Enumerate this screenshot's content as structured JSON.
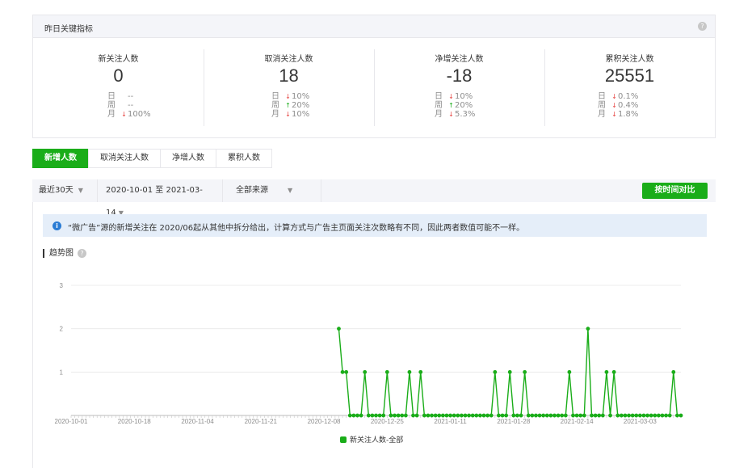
{
  "kpi": {
    "title": "昨日关键指标",
    "help": "?",
    "items": [
      {
        "label": "新关注人数",
        "value": "0",
        "rows": [
          {
            "k": "日",
            "arrow": "",
            "dir": "",
            "v": "--"
          },
          {
            "k": "周",
            "arrow": "",
            "dir": "",
            "v": "--"
          },
          {
            "k": "月",
            "arrow": "↓",
            "dir": "down",
            "v": "100%"
          }
        ]
      },
      {
        "label": "取消关注人数",
        "value": "18",
        "rows": [
          {
            "k": "日",
            "arrow": "↓",
            "dir": "down",
            "v": "10%"
          },
          {
            "k": "周",
            "arrow": "↑",
            "dir": "up",
            "v": "20%"
          },
          {
            "k": "月",
            "arrow": "↓",
            "dir": "down",
            "v": "10%"
          }
        ]
      },
      {
        "label": "净增关注人数",
        "value": "-18",
        "rows": [
          {
            "k": "日",
            "arrow": "↓",
            "dir": "down",
            "v": "10%"
          },
          {
            "k": "周",
            "arrow": "↑",
            "dir": "up",
            "v": "20%"
          },
          {
            "k": "月",
            "arrow": "↓",
            "dir": "down",
            "v": "5.3%"
          }
        ]
      },
      {
        "label": "累积关注人数",
        "value": "25551",
        "rows": [
          {
            "k": "日",
            "arrow": "↓",
            "dir": "down",
            "v": "0.1%"
          },
          {
            "k": "周",
            "arrow": "↓",
            "dir": "down",
            "v": "0.4%"
          },
          {
            "k": "月",
            "arrow": "↓",
            "dir": "down",
            "v": "1.8%"
          }
        ]
      }
    ]
  },
  "tabs": [
    {
      "label": "新增人数",
      "active": true
    },
    {
      "label": "取消关注人数",
      "active": false
    },
    {
      "label": "净增人数",
      "active": false
    },
    {
      "label": "累积人数",
      "active": false
    }
  ],
  "filters": {
    "period": "最近30天",
    "date_range": "2020-10-01 至 2021-03-14",
    "source": "全部来源",
    "caret": "▼",
    "compare_label": "按时间对比"
  },
  "notice": {
    "icon": "i",
    "text": "“微广告”源的新增关注在 2020/06起从其他中拆分给出，计算方式与广告主页面关注次数略有不同，因此两者数值可能不一样。"
  },
  "trend": {
    "title": "趋势图",
    "help": "?"
  },
  "colors": {
    "accent": "#1aad19",
    "down": "#e64340",
    "up": "#1aad19"
  },
  "chart_data": {
    "type": "line",
    "x_start": "2020-10-01",
    "x_end": "2021-03-14",
    "x_ticks": [
      "2020-10-01",
      "2020-10-18",
      "2020-11-04",
      "2020-11-21",
      "2020-12-08",
      "2020-12-25",
      "2021-01-11",
      "2021-01-28",
      "2021-02-14",
      "2021-03-03"
    ],
    "y_ticks": [
      1,
      2,
      3
    ],
    "ylim": [
      0,
      3
    ],
    "series": [
      {
        "name": "新关注人数-全部",
        "points": [
          [
            "2020-12-12",
            2
          ],
          [
            "2020-12-13",
            1
          ],
          [
            "2020-12-14",
            1
          ],
          [
            "2020-12-15",
            0
          ],
          [
            "2020-12-16",
            0
          ],
          [
            "2020-12-17",
            0
          ],
          [
            "2020-12-18",
            0
          ],
          [
            "2020-12-19",
            1
          ],
          [
            "2020-12-20",
            0
          ],
          [
            "2020-12-21",
            0
          ],
          [
            "2020-12-22",
            0
          ],
          [
            "2020-12-23",
            0
          ],
          [
            "2020-12-24",
            0
          ],
          [
            "2020-12-25",
            1
          ],
          [
            "2020-12-26",
            0
          ],
          [
            "2020-12-27",
            0
          ],
          [
            "2020-12-28",
            0
          ],
          [
            "2020-12-29",
            0
          ],
          [
            "2020-12-30",
            0
          ],
          [
            "2020-12-31",
            1
          ],
          [
            "2021-01-01",
            0
          ],
          [
            "2021-01-02",
            0
          ],
          [
            "2021-01-03",
            1
          ],
          [
            "2021-01-04",
            0
          ],
          [
            "2021-01-05",
            0
          ],
          [
            "2021-01-06",
            0
          ],
          [
            "2021-01-07",
            0
          ],
          [
            "2021-01-08",
            0
          ],
          [
            "2021-01-09",
            0
          ],
          [
            "2021-01-10",
            0
          ],
          [
            "2021-01-11",
            0
          ],
          [
            "2021-01-12",
            0
          ],
          [
            "2021-01-13",
            0
          ],
          [
            "2021-01-14",
            0
          ],
          [
            "2021-01-15",
            0
          ],
          [
            "2021-01-16",
            0
          ],
          [
            "2021-01-17",
            0
          ],
          [
            "2021-01-18",
            0
          ],
          [
            "2021-01-19",
            0
          ],
          [
            "2021-01-20",
            0
          ],
          [
            "2021-01-21",
            0
          ],
          [
            "2021-01-22",
            0
          ],
          [
            "2021-01-23",
            1
          ],
          [
            "2021-01-24",
            0
          ],
          [
            "2021-01-25",
            0
          ],
          [
            "2021-01-26",
            0
          ],
          [
            "2021-01-27",
            1
          ],
          [
            "2021-01-28",
            0
          ],
          [
            "2021-01-29",
            0
          ],
          [
            "2021-01-30",
            0
          ],
          [
            "2021-01-31",
            1
          ],
          [
            "2021-02-01",
            0
          ],
          [
            "2021-02-02",
            0
          ],
          [
            "2021-02-03",
            0
          ],
          [
            "2021-02-04",
            0
          ],
          [
            "2021-02-05",
            0
          ],
          [
            "2021-02-06",
            0
          ],
          [
            "2021-02-07",
            0
          ],
          [
            "2021-02-08",
            0
          ],
          [
            "2021-02-09",
            0
          ],
          [
            "2021-02-10",
            0
          ],
          [
            "2021-02-11",
            0
          ],
          [
            "2021-02-12",
            1
          ],
          [
            "2021-02-13",
            0
          ],
          [
            "2021-02-14",
            0
          ],
          [
            "2021-02-15",
            0
          ],
          [
            "2021-02-16",
            0
          ],
          [
            "2021-02-17",
            2
          ],
          [
            "2021-02-18",
            0
          ],
          [
            "2021-02-19",
            0
          ],
          [
            "2021-02-20",
            0
          ],
          [
            "2021-02-21",
            0
          ],
          [
            "2021-02-22",
            1
          ],
          [
            "2021-02-23",
            0
          ],
          [
            "2021-02-24",
            1
          ],
          [
            "2021-02-25",
            0
          ],
          [
            "2021-02-26",
            0
          ],
          [
            "2021-02-27",
            0
          ],
          [
            "2021-02-28",
            0
          ],
          [
            "2021-03-01",
            0
          ],
          [
            "2021-03-02",
            0
          ],
          [
            "2021-03-03",
            0
          ],
          [
            "2021-03-04",
            0
          ],
          [
            "2021-03-05",
            0
          ],
          [
            "2021-03-06",
            0
          ],
          [
            "2021-03-07",
            0
          ],
          [
            "2021-03-08",
            0
          ],
          [
            "2021-03-09",
            0
          ],
          [
            "2021-03-10",
            0
          ],
          [
            "2021-03-11",
            0
          ],
          [
            "2021-03-12",
            1
          ],
          [
            "2021-03-13",
            0
          ],
          [
            "2021-03-14",
            0
          ]
        ]
      }
    ],
    "legend": "bottom"
  }
}
